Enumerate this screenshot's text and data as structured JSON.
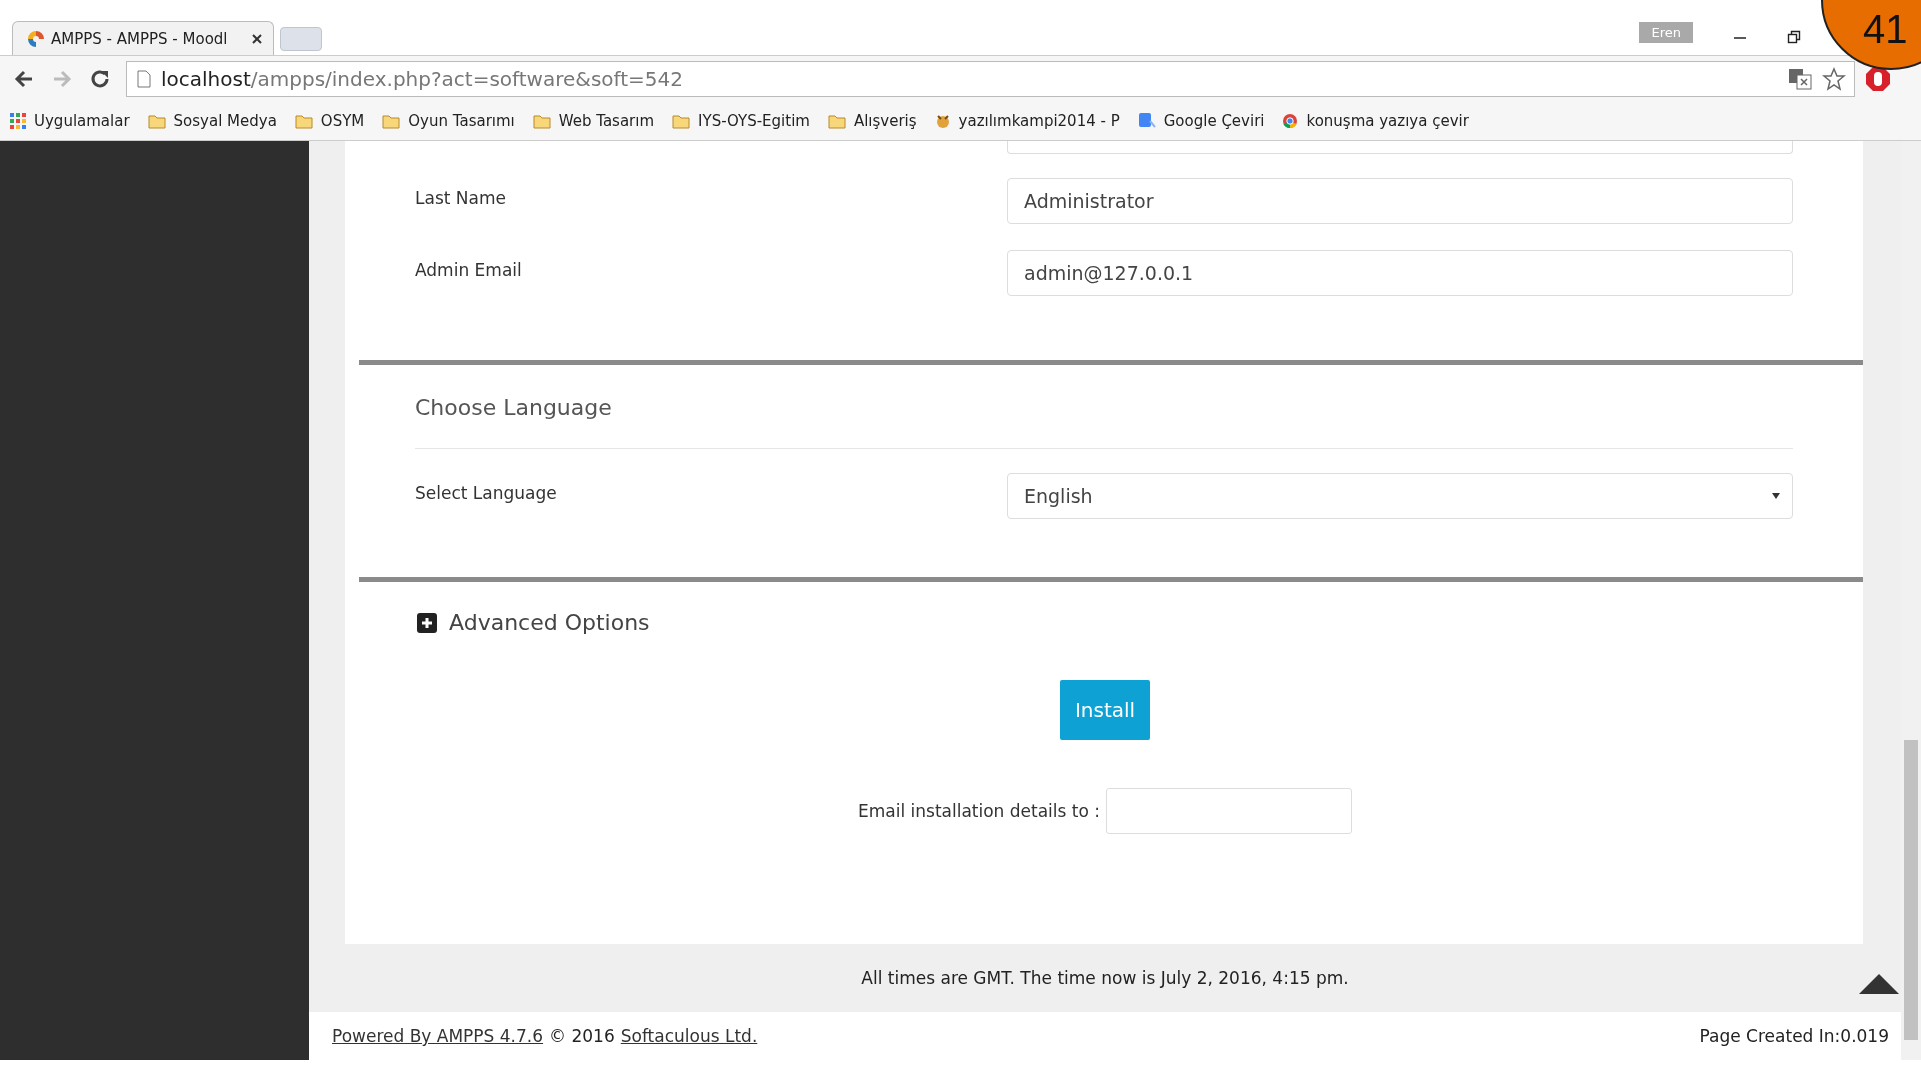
{
  "browser": {
    "tab_title": "AMPPS - AMPPS - Moodl",
    "profile": "Eren",
    "url_host": "localhost",
    "url_path": "/ampps/index.php?act=software&soft=542",
    "bookmarks": [
      {
        "kind": "apps",
        "label": "Uygulamalar"
      },
      {
        "kind": "folder",
        "label": "Sosyal Medya"
      },
      {
        "kind": "folder",
        "label": "OSYM"
      },
      {
        "kind": "folder",
        "label": "Oyun Tasarımı"
      },
      {
        "kind": "folder",
        "label": "Web Tasarım"
      },
      {
        "kind": "folder",
        "label": "IYS-OYS-Egitim"
      },
      {
        "kind": "folder",
        "label": "Alışveriş"
      },
      {
        "kind": "site",
        "label": "yazılımkampi2014 - P"
      },
      {
        "kind": "translate",
        "label": "Google Çeviri"
      },
      {
        "kind": "chrome",
        "label": "konuşma yazıya çevir"
      }
    ]
  },
  "badge": "41",
  "form": {
    "fields": [
      {
        "label": "Last Name",
        "value": "Administrator"
      },
      {
        "label": "Admin Email",
        "value": "admin@127.0.0.1"
      }
    ],
    "language_section": {
      "title": "Choose Language",
      "label": "Select Language",
      "value": "English"
    },
    "advanced": {
      "label": "Advanced Options",
      "expanded": false
    },
    "install_button": "Install",
    "email_label": "Email installation details to :"
  },
  "footer": {
    "time_note": "All times are GMT. The time now is July 2, 2016, 4:15 pm.",
    "powered": "Powered By AMPPS 4.7.6",
    "copyright": "© 2016",
    "company": "Softaculous Ltd.",
    "page_created": "Page Created In:0.019"
  }
}
